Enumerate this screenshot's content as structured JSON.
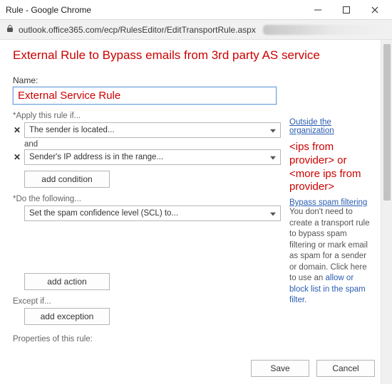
{
  "window": {
    "title": "Rule - Google Chrome"
  },
  "addressbar": {
    "url": "outlook.office365.com/ecp/RulesEditor/EditTransportRule.aspx"
  },
  "page": {
    "title": "External Rule to Bypass emails from 3rd party AS service"
  },
  "form": {
    "name_label": "Name:",
    "name_value": "External Service Rule",
    "apply_if_label": "*Apply this rule if...",
    "condition1": "The sender is located...",
    "and_label": "and",
    "condition2": "Sender's IP address is in the range...",
    "add_condition_btn": "add condition",
    "do_following_label": "*Do the following...",
    "action1": "Set the spam confidence level (SCL) to...",
    "add_action_btn": "add action",
    "except_if_label": "Except if...",
    "add_exception_btn": "add exception",
    "properties_label": "Properties of this rule:"
  },
  "side": {
    "outside_link": "Outside the organization",
    "red_annotation": "<ips from provider> or <more ips from provider>",
    "bypass_title": "Bypass spam filtering",
    "bypass_body_1": "You don't need to create a transport rule to bypass spam filtering or mark email as spam for a sender or domain. Click here to use an ",
    "bypass_link": "allow or block list in the spam filter.",
    "bypass_body_2": ""
  },
  "footer": {
    "save": "Save",
    "cancel": "Cancel"
  }
}
